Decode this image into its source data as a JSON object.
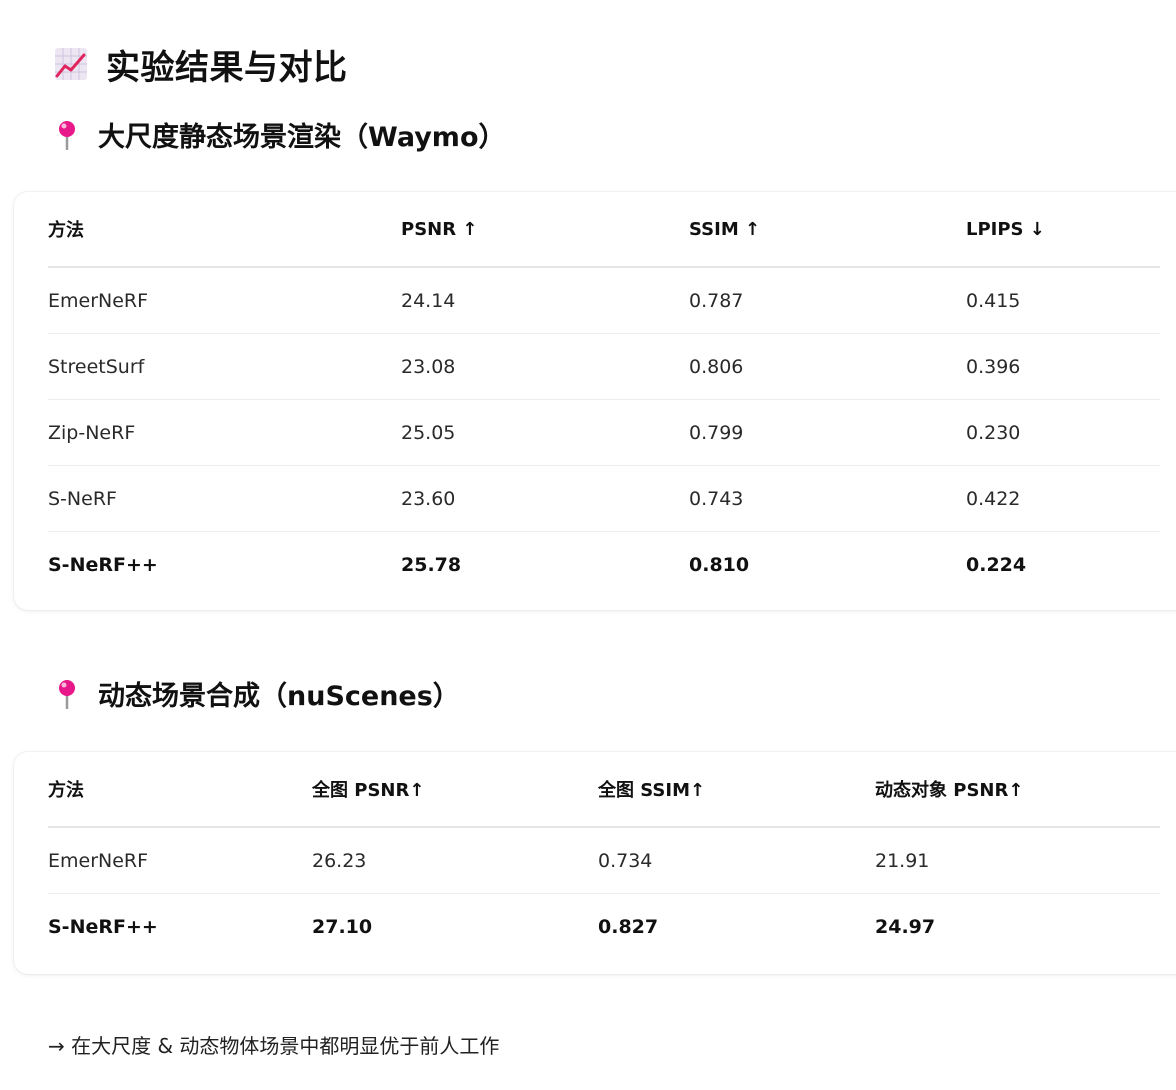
{
  "title": "实验结果与对比",
  "section1": {
    "heading": "大尺度静态场景渲染（Waymo）",
    "headers": [
      "方法",
      "PSNR ↑",
      "SSIM ↑",
      "LPIPS ↓"
    ],
    "rows": [
      [
        "EmerNeRF",
        "24.14",
        "0.787",
        "0.415"
      ],
      [
        "StreetSurf",
        "23.08",
        "0.806",
        "0.396"
      ],
      [
        "Zip-NeRF",
        "25.05",
        "0.799",
        "0.230"
      ],
      [
        "S-NeRF",
        "23.60",
        "0.743",
        "0.422"
      ],
      [
        "S-NeRF++",
        "25.78",
        "0.810",
        "0.224"
      ]
    ]
  },
  "section2": {
    "heading": "动态场景合成（nuScenes）",
    "headers": [
      "方法",
      "全图 PSNR↑",
      "全图 SSIM↑",
      "动态对象 PSNR↑"
    ],
    "rows": [
      [
        "EmerNeRF",
        "26.23",
        "0.734",
        "21.91"
      ],
      [
        "S-NeRF++",
        "27.10",
        "0.827",
        "24.97"
      ]
    ]
  },
  "footnote": "→ 在大尺度 & 动态物体场景中都明显优于前人工作",
  "icons": {
    "title": "chart-increasing-icon",
    "section": "pushpin-icon"
  },
  "colors": {
    "pin": "#e8178a",
    "chart_line": "#e0245e",
    "chart_bg": "#ece6f3"
  }
}
